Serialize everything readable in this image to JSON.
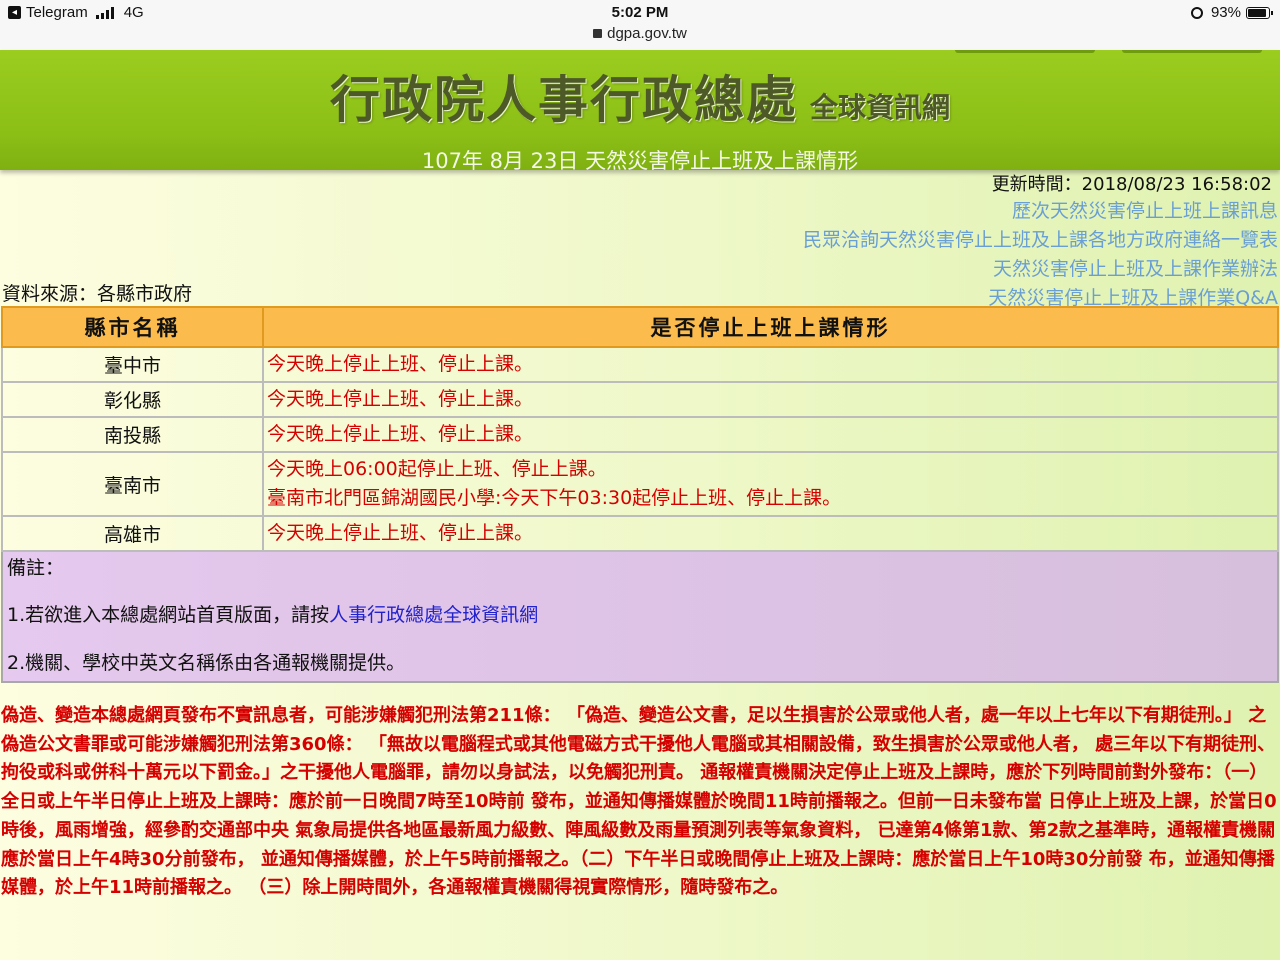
{
  "status_bar": {
    "app": "Telegram",
    "network": "4G",
    "time": "5:02 PM",
    "url": "dgpa.gov.tw",
    "battery": "93%"
  },
  "header": {
    "title": "行政院人事行政總處",
    "subtitle": "全球資訊網",
    "date_line": "107年 8月 23日 天然災害停止上班及上課情形"
  },
  "update_time": "更新時間：2018/08/23 16:58:02",
  "links": [
    "歷次天然災害停止上班上課訊息",
    "民眾洽詢天然災害停止上班及上課各地方政府連絡一覽表",
    "天然災害停止上班及上課作業辦法",
    "天然災害停止上班及上課作業Q&A"
  ],
  "source": "資料來源：各縣市政府",
  "table": {
    "headers": [
      "縣市名稱",
      "是否停止上班上課情形"
    ],
    "rows": [
      {
        "city": "臺中市",
        "lines": [
          "今天晚上停止上班、停止上課。"
        ]
      },
      {
        "city": "彰化縣",
        "lines": [
          "今天晚上停止上班、停止上課。"
        ]
      },
      {
        "city": "南投縣",
        "lines": [
          "今天晚上停止上班、停止上課。"
        ]
      },
      {
        "city": "臺南市",
        "lines": [
          "今天晚上06:00起停止上班、停止上課。",
          "臺南市北門區錦湖國民小學:今天下午03:30起停止上班、停止上課。"
        ]
      },
      {
        "city": "高雄市",
        "lines": [
          "今天晚上停止上班、停止上課。"
        ]
      }
    ]
  },
  "notes": {
    "label": "備註：",
    "n1_prefix": "1.若欲進入本總處網站首頁版面，請按",
    "n1_link": "人事行政總處全球資訊網",
    "n2": "2.機關、學校中英文名稱係由各通報機關提供。"
  },
  "warning": "偽造、變造本總處網頁發布不實訊息者，可能涉嫌觸犯刑法第211條： 「偽造、變造公文書，足以生損害於公眾或他人者，處一年以上七年以下有期徒刑。」 之偽造公文書罪或可能涉嫌觸犯刑法第360條： 「無故以電腦程式或其他電磁方式干擾他人電腦或其相關設備，致生損害於公眾或他人者， 處三年以下有期徒刑、拘役或科或併科十萬元以下罰金。」之干擾他人電腦罪，請勿以身試法，以免觸犯刑責。 通報權責機關決定停止上班及上課時，應於下列時間前對外發布：（一）全日或上午半日停止上班及上課時：應於前一日晚間7時至10時前 發布，並通知傳播媒體於晚間11時前播報之。但前一日未發布當 日停止上班及上課，於當日0時後，風雨增強，經參酌交通部中央 氣象局提供各地區最新風力級數、陣風級數及雨量預測列表等氣象資料， 已達第4條第1款、第2款之基準時，通報權責機關應於當日上午4時30分前發布， 並通知傳播媒體，於上午5時前播報之。（二）下午半日或晚間停止上班及上課時：應於當日上午10時30分前發 布，並通知傳播媒體，於上午11時前播報之。 （三）除上開時間外，各通報權責機關得視實際情形，隨時發布之。"
}
